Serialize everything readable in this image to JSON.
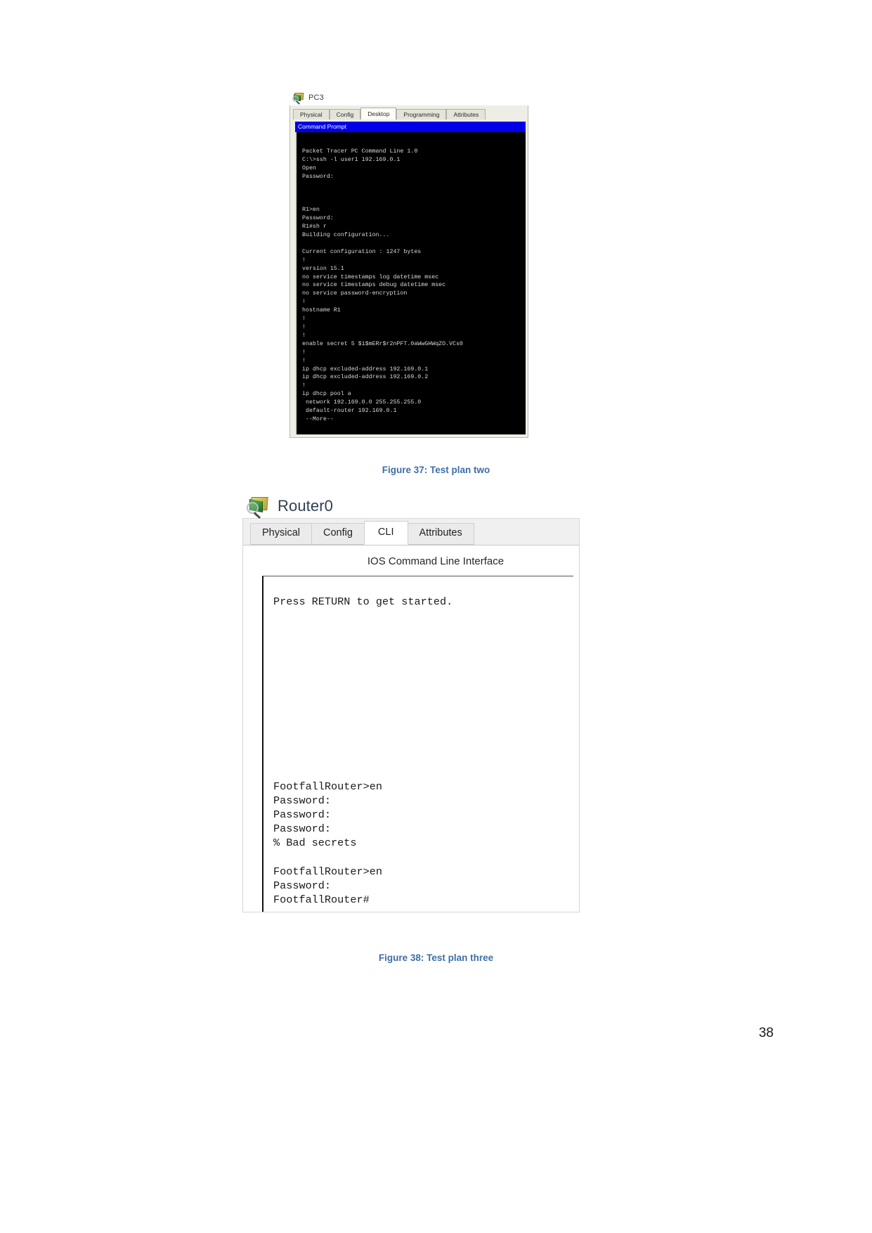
{
  "page": {
    "number": "38"
  },
  "figure1": {
    "device_name": "PC3",
    "device_icon": "packet-tracer-device-icon",
    "tabs": [
      {
        "label": "Physical",
        "active": false
      },
      {
        "label": "Config",
        "active": false
      },
      {
        "label": "Desktop",
        "active": true
      },
      {
        "label": "Programming",
        "active": false
      },
      {
        "label": "Attributes",
        "active": false
      }
    ],
    "app_title": "Command Prompt",
    "terminal_text": "\nPacket Tracer PC Command Line 1.0\nC:\\>ssh -l user1 192.169.0.1\nOpen\nPassword:\n\n\n\nR1>en\nPassword:\nR1#sh r\nBuilding configuration...\n\nCurrent configuration : 1247 bytes\n!\nversion 15.1\nno service timestamps log datetime msec\nno service timestamps debug datetime msec\nno service password-encryption\n!\nhostname R1\n!\n!\n!\nenable secret 5 $1$mERr$r2nPFT.0aWwGHWqZO.VCs0\n!\n!\nip dhcp excluded-address 192.169.0.1\nip dhcp excluded-address 192.169.0.2\n!\nip dhcp pool a\n network 192.169.0.0 255.255.255.0\n default-router 192.169.0.1\n --More--",
    "caption": "Figure 37: Test plan two"
  },
  "figure2": {
    "device_name": "Router0",
    "device_icon": "packet-tracer-device-icon",
    "tabs": [
      {
        "label": "Physical",
        "active": false
      },
      {
        "label": "Config",
        "active": false
      },
      {
        "label": "CLI",
        "active": true
      },
      {
        "label": "Attributes",
        "active": false
      }
    ],
    "panel_heading": "IOS Command Line Interface",
    "cli_text": "Press RETURN to get started.\n\n\n\n\n\n\n\n\n\n\n\n\nFootfallRouter>en\nPassword:\nPassword:\nPassword:\n% Bad secrets\n\nFootfallRouter>en\nPassword:\nFootfallRouter#",
    "caption": "Figure 38: Test plan three"
  },
  "colors": {
    "caption": "#3f6ea5",
    "command_prompt_bar": "#0000e8",
    "terminal_bg": "#000000",
    "terminal_fg": "#d8d8d8"
  }
}
